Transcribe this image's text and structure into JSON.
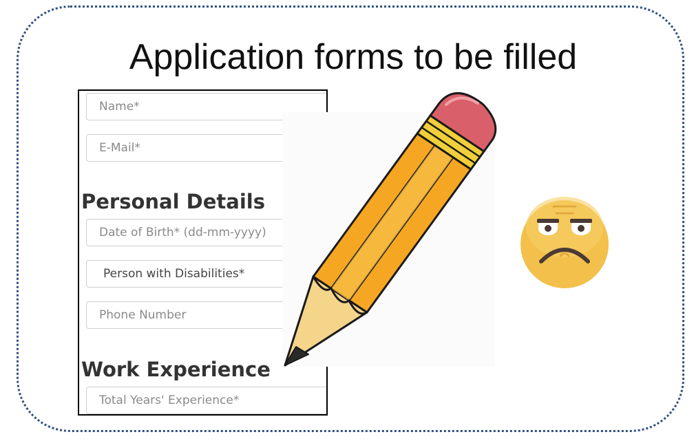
{
  "slide": {
    "title": "Application forms to be filled"
  },
  "form": {
    "name_placeholder": "Name*",
    "email_placeholder": "E-Mail*",
    "personal_details_heading": "Personal Details",
    "dob_placeholder": "Date of Birth* (dd-mm-yyyy)",
    "disability_select_value": "Person with Disabilities*",
    "phone_placeholder": "Phone Number",
    "work_experience_heading": "Work Experience",
    "total_experience_placeholder": "Total Years' Experience*"
  },
  "illustrations": {
    "pencil": "pencil-icon",
    "emoji": "frowning-face-icon"
  },
  "colors": {
    "frame_border": "#2f4f7f",
    "pencil_body": "#f5a623",
    "pencil_eraser": "#d9606a",
    "emoji_face": "#f2c04b"
  }
}
